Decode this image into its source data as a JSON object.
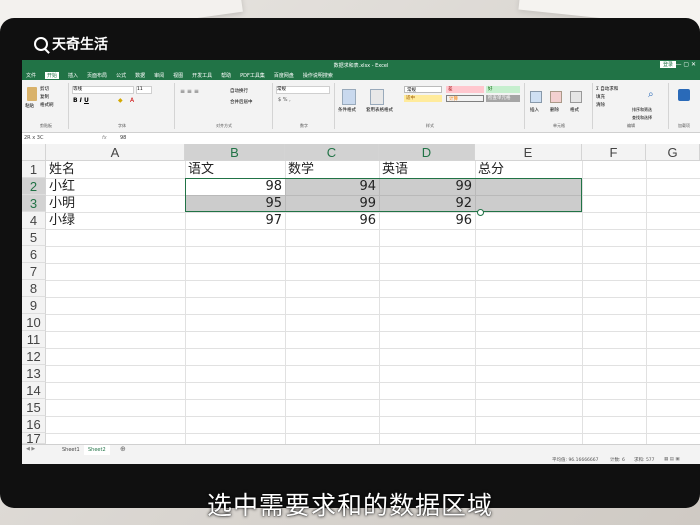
{
  "overlay": {
    "brand": "天奇生活",
    "caption": "选中需要求和的数据区域"
  },
  "window": {
    "title": "数据求和表.xlsx - Excel",
    "signin": "登录"
  },
  "menu": [
    "文件",
    "开始",
    "插入",
    "页面布局",
    "公式",
    "数据",
    "审阅",
    "视图",
    "开发工具",
    "帮助",
    "PDF工具集",
    "百度网盘",
    "操作说明搜索"
  ],
  "ribbon": {
    "clipboard": {
      "paste": "粘贴",
      "cut": "剪切",
      "copy": "复制",
      "format_painter": "格式刷",
      "label": "剪贴板"
    },
    "font": {
      "name": "等线",
      "size": "11",
      "label": "字体"
    },
    "alignment": {
      "wrap": "自动换行",
      "merge": "合并后居中",
      "label": "对齐方式"
    },
    "number": {
      "format": "常规",
      "label": "数字"
    },
    "styles": {
      "conditional": "条件格式",
      "table": "套用表格格式",
      "normal": "常规",
      "bad": "差",
      "good": "好",
      "neutral": "适中",
      "calc": "计算",
      "check": "检查单元格",
      "label": "样式"
    },
    "cells": {
      "insert": "插入",
      "delete": "删除",
      "format": "格式",
      "label": "单元格"
    },
    "editing": {
      "autosum": "自动求和",
      "fill": "填充",
      "clear": "清除",
      "sort": "排序和筛选",
      "find": "查找和选择",
      "label": "编辑"
    },
    "addins": {
      "label": "加载项"
    }
  },
  "formula_bar": {
    "namebox": "2R x 3C",
    "fx": "fx",
    "value": "98"
  },
  "columns": [
    "A",
    "B",
    "C",
    "D",
    "E",
    "F",
    "G"
  ],
  "rows": [
    "1",
    "2",
    "3",
    "4",
    "5",
    "6",
    "7",
    "8",
    "9",
    "10",
    "11",
    "12",
    "13",
    "14",
    "15",
    "16",
    "17"
  ],
  "table": {
    "header": [
      "姓名",
      "语文",
      "数学",
      "英语",
      "总分"
    ],
    "rows": [
      [
        "小红",
        "98",
        "94",
        "99",
        ""
      ],
      [
        "小明",
        "95",
        "99",
        "92",
        ""
      ],
      [
        "小绿",
        "97",
        "96",
        "96",
        ""
      ]
    ]
  },
  "sheets": [
    "Sheet1",
    "Sheet2"
  ],
  "status": {
    "average": "平均值: 96.16666667",
    "count": "计数: 6",
    "sum": "求和: 577"
  }
}
